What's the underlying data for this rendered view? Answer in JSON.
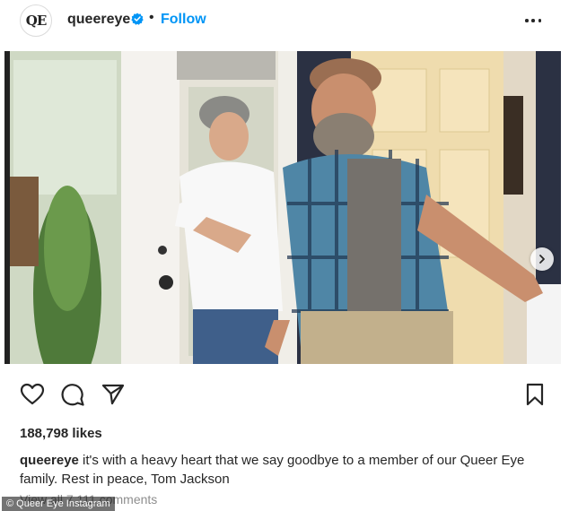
{
  "post": {
    "account": {
      "avatar_text": "QE",
      "username": "queereye",
      "verified": true,
      "separator": "•",
      "follow_label": "Follow"
    },
    "media": {
      "carousel_dots": 4,
      "active_dot": 1
    },
    "likes_text": "188,798 likes",
    "caption": {
      "username": "queereye",
      "text": "it's with a heavy heart that we say goodbye to a member of our Queer Eye family. Rest in peace, Tom Jackson"
    },
    "comments_link": "View all 7,111 comments"
  },
  "icons": {
    "verified": "verified-badge-icon",
    "more": "more-options-icon",
    "like": "heart-icon",
    "comment": "comment-bubble-icon",
    "share": "paper-plane-icon",
    "save": "bookmark-icon",
    "next": "chevron-right-icon"
  },
  "photo_credit": "© Queer Eye Instagram",
  "colors": {
    "link_blue": "#0095f6",
    "text": "#262626",
    "muted": "#8e8e8e"
  }
}
